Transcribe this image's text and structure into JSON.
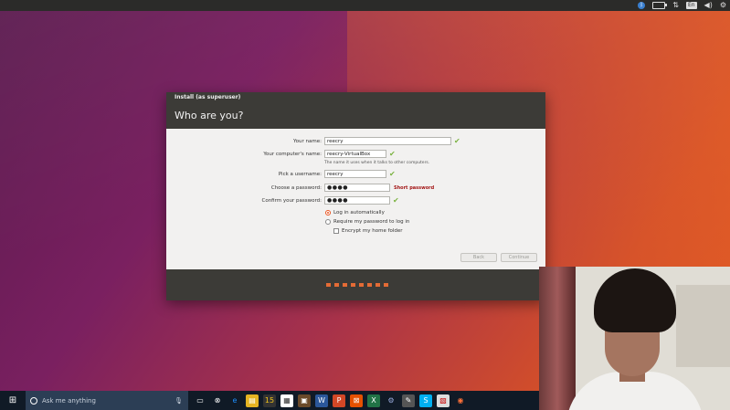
{
  "top_panel": {
    "keyboard_label": "En"
  },
  "installer": {
    "window_title": "Install (as superuser)",
    "header": "Who are you?",
    "labels": {
      "your_name": "Your name:",
      "computer_name": "Your computer's name:",
      "username": "Pick a username:",
      "password": "Choose a password:",
      "confirm_password": "Confirm your password:"
    },
    "values": {
      "your_name": "reecry",
      "computer_name": "reecry-VirtualBox",
      "username": "reecry",
      "password": "●●●●",
      "confirm_password": "●●●●"
    },
    "computer_name_hint": "The name it uses when it talks to other computers.",
    "password_strength": "Short password",
    "options": {
      "login_auto": "Log in automatically",
      "require_password": "Require my password to log in",
      "encrypt_home": "Encrypt my home folder"
    },
    "buttons": {
      "back": "Back",
      "continue": "Continue"
    }
  },
  "taskbar": {
    "search_placeholder": "Ask me anything"
  }
}
